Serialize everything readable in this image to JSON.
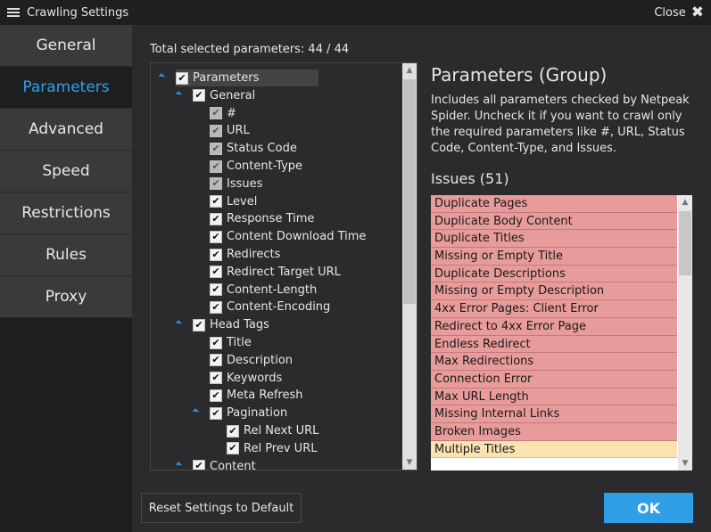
{
  "window": {
    "title": "Crawling Settings",
    "close_label": "Close"
  },
  "sidebar": {
    "items": [
      {
        "label": "General",
        "active": false
      },
      {
        "label": "Parameters",
        "active": true
      },
      {
        "label": "Advanced",
        "active": false
      },
      {
        "label": "Speed",
        "active": false
      },
      {
        "label": "Restrictions",
        "active": false
      },
      {
        "label": "Rules",
        "active": false
      },
      {
        "label": "Proxy",
        "active": false
      }
    ]
  },
  "main": {
    "total_label": "Total selected parameters: 44 / 44",
    "tree": [
      {
        "label": "Parameters",
        "checked": true,
        "expand": true,
        "selected": true,
        "disabled": false
      },
      {
        "label": "General",
        "checked": true,
        "expand": true,
        "selected": false,
        "disabled": false
      },
      {
        "label": "#",
        "checked": true,
        "expand": false,
        "selected": false,
        "disabled": true
      },
      {
        "label": "URL",
        "checked": true,
        "expand": false,
        "selected": false,
        "disabled": true
      },
      {
        "label": "Status Code",
        "checked": true,
        "expand": false,
        "selected": false,
        "disabled": true
      },
      {
        "label": "Content-Type",
        "checked": true,
        "expand": false,
        "selected": false,
        "disabled": true
      },
      {
        "label": "Issues",
        "checked": true,
        "expand": false,
        "selected": false,
        "disabled": true
      },
      {
        "label": "Level",
        "checked": true,
        "expand": false,
        "selected": false,
        "disabled": false
      },
      {
        "label": "Response Time",
        "checked": true,
        "expand": false,
        "selected": false,
        "disabled": false
      },
      {
        "label": "Content Download Time",
        "checked": true,
        "expand": false,
        "selected": false,
        "disabled": false
      },
      {
        "label": "Redirects",
        "checked": true,
        "expand": false,
        "selected": false,
        "disabled": false
      },
      {
        "label": "Redirect Target URL",
        "checked": true,
        "expand": false,
        "selected": false,
        "disabled": false
      },
      {
        "label": "Content-Length",
        "checked": true,
        "expand": false,
        "selected": false,
        "disabled": false
      },
      {
        "label": "Content-Encoding",
        "checked": true,
        "expand": false,
        "selected": false,
        "disabled": false
      },
      {
        "label": "Head Tags",
        "checked": true,
        "expand": true,
        "selected": false,
        "disabled": false
      },
      {
        "label": "Title",
        "checked": true,
        "expand": false,
        "selected": false,
        "disabled": false
      },
      {
        "label": "Description",
        "checked": true,
        "expand": false,
        "selected": false,
        "disabled": false
      },
      {
        "label": "Keywords",
        "checked": true,
        "expand": false,
        "selected": false,
        "disabled": false
      },
      {
        "label": "Meta Refresh",
        "checked": true,
        "expand": false,
        "selected": false,
        "disabled": false
      },
      {
        "label": "Pagination",
        "checked": true,
        "expand": true,
        "selected": false,
        "disabled": false
      },
      {
        "label": "Rel Next URL",
        "checked": true,
        "expand": false,
        "selected": false,
        "disabled": false
      },
      {
        "label": "Rel Prev URL",
        "checked": true,
        "expand": false,
        "selected": false,
        "disabled": false
      },
      {
        "label": "Content",
        "checked": true,
        "expand": true,
        "selected": false,
        "disabled": false
      }
    ],
    "info": {
      "title": "Parameters (Group)",
      "description": "Includes all parameters checked by Netpeak Spider. Uncheck it if you want to crawl only the required parameters like #, URL, Status Code, Content-Type, and Issues."
    },
    "issues_title": "Issues (51)",
    "issues": [
      {
        "label": "Duplicate Pages",
        "severity": "error"
      },
      {
        "label": "Duplicate Body Content",
        "severity": "error"
      },
      {
        "label": "Duplicate Titles",
        "severity": "error"
      },
      {
        "label": "Missing or Empty Title",
        "severity": "error"
      },
      {
        "label": "Duplicate Descriptions",
        "severity": "error"
      },
      {
        "label": "Missing or Empty Description",
        "severity": "error"
      },
      {
        "label": "4xx Error Pages: Client Error",
        "severity": "error"
      },
      {
        "label": "Redirect to 4xx Error Page",
        "severity": "error"
      },
      {
        "label": "Endless Redirect",
        "severity": "error"
      },
      {
        "label": "Max Redirections",
        "severity": "error"
      },
      {
        "label": "Connection Error",
        "severity": "error"
      },
      {
        "label": "Max URL Length",
        "severity": "error"
      },
      {
        "label": "Missing Internal Links",
        "severity": "error"
      },
      {
        "label": "Broken Images",
        "severity": "error"
      },
      {
        "label": "Multiple Titles",
        "severity": "warning"
      }
    ]
  },
  "buttons": {
    "reset_label": "Reset Settings to Default",
    "ok_label": "OK"
  },
  "colors": {
    "accent": "#2e9ee6",
    "error_row": "#e89b9b",
    "warning_row": "#fbe3b1",
    "panel_bg": "#2b2b2e",
    "sidebar_bg": "#1f1f21"
  }
}
